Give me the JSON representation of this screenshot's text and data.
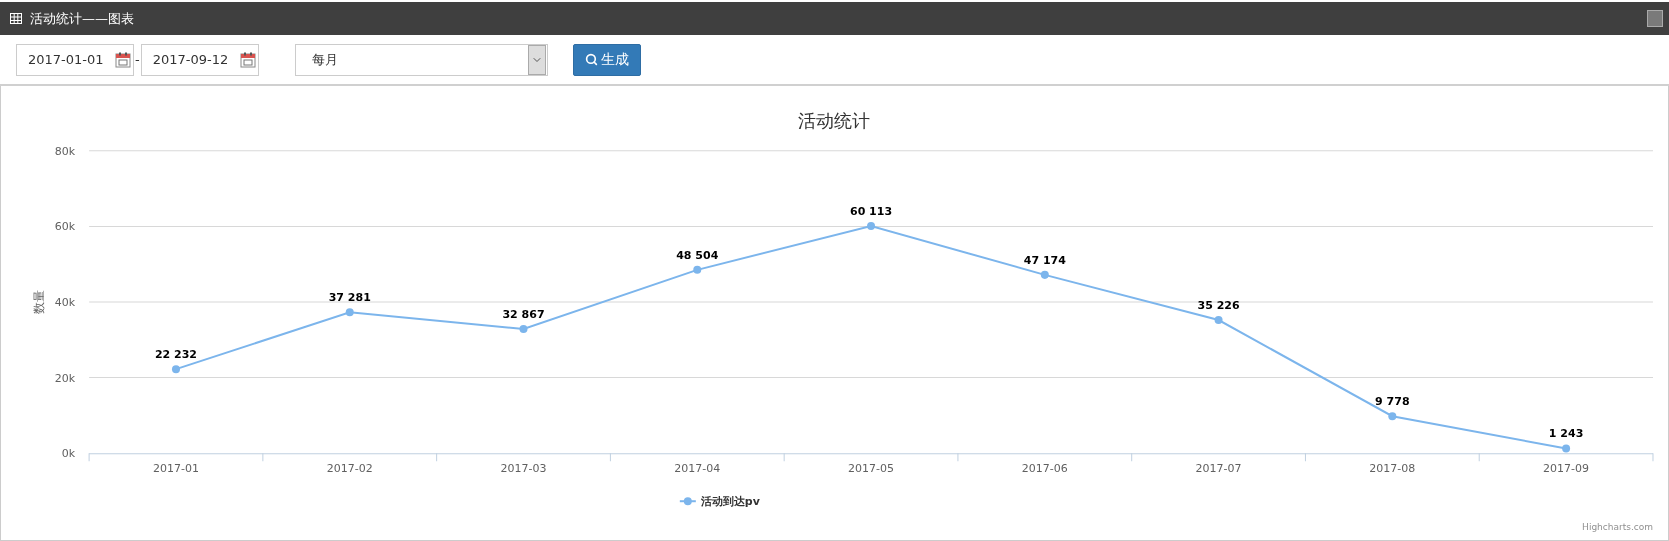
{
  "window": {
    "title": "活动统计——图表"
  },
  "toolbar": {
    "start_date": "2017-01-01",
    "separator": "-",
    "end_date": "2017-09-12",
    "period": "每月",
    "generate_button": "生成"
  },
  "chart": {
    "credits": "Highcharts.com",
    "chart_data": {
      "type": "line",
      "title": "活动统计",
      "ylabel": "数量",
      "categories": [
        "2017-01",
        "2017-02",
        "2017-03",
        "2017-04",
        "2017-05",
        "2017-06",
        "2017-07",
        "2017-08",
        "2017-09"
      ],
      "grid": true,
      "series": [
        {
          "name": "活动到达pv",
          "color": "#7cb5ec",
          "marker": true,
          "values": [
            22232,
            37281,
            32867,
            48504,
            60113,
            47174,
            35226,
            9778,
            1243
          ]
        }
      ],
      "value_labels": [
        "22 232",
        "37 281",
        "32 867",
        "48 504",
        "60 113",
        "47 174",
        "35 226",
        "9 778",
        "1 243"
      ],
      "ylim": [
        0,
        80000
      ],
      "yticks": [
        {
          "value": 0,
          "label": "0k"
        },
        {
          "value": 20000,
          "label": "20k"
        },
        {
          "value": 40000,
          "label": "40k"
        },
        {
          "value": 60000,
          "label": "60k"
        },
        {
          "value": 80000,
          "label": "80k"
        }
      ],
      "data_labels": true
    }
  }
}
